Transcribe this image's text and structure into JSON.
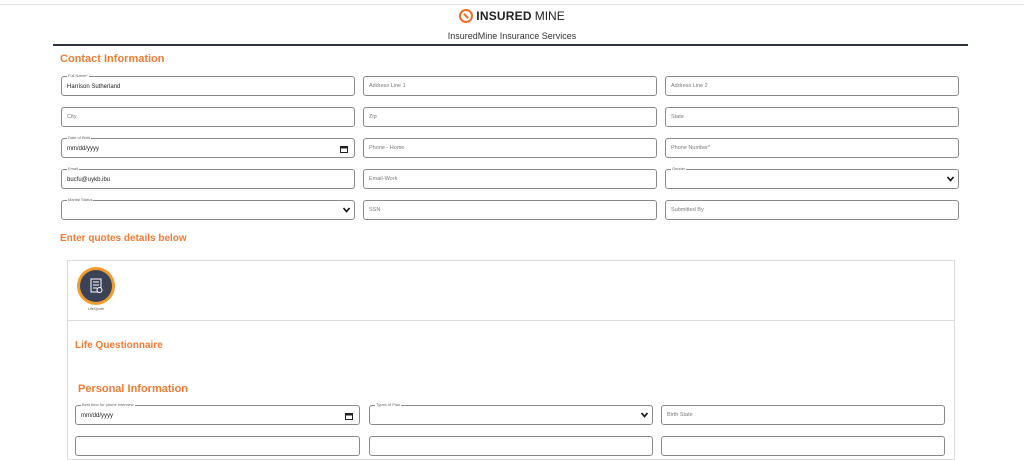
{
  "brand": {
    "name_bold": "INSURED",
    "name_light": "MINE",
    "subtitle": "InsuredMine Insurance Services"
  },
  "contact": {
    "title": "Contact Information",
    "full_name_label": "Full Name*",
    "full_name_value": "Harrison Sutherland",
    "address1_placeholder": "Address Line 1",
    "address2_placeholder": "Address Line 2",
    "city_placeholder": "City",
    "zip_placeholder": "Zip",
    "state_placeholder": "State",
    "dob_label": "Date of Birth",
    "dob_value": "mm/dd/yyyy",
    "phone_home_placeholder": "Phone - Home",
    "phone_number_placeholder": "Phone Number*",
    "email_label": "Email",
    "email_value": "bucfu@uykb.ibu",
    "email_work_placeholder": "Email-Work",
    "gender_label": "Gender",
    "gender_value": "",
    "marital_label": "Marital Status",
    "marital_value": "",
    "ssn_placeholder": "SSN",
    "submitted_by_placeholder": "Submitted By"
  },
  "quotes": {
    "title": "Enter quotes details below",
    "tile_label": "Life/Quote",
    "life_title": "Life Questionnaire",
    "personal_title": "Personal Information",
    "best_time_label": "Best time for phone interview",
    "best_time_value": "mm/dd/yyyy",
    "types_of_plan_label": "Types of Plan",
    "birth_state_placeholder": "Birth State"
  },
  "colors": {
    "accent": "#f07b33",
    "header_rule": "#2e3440",
    "border": "#8a8a8a"
  }
}
